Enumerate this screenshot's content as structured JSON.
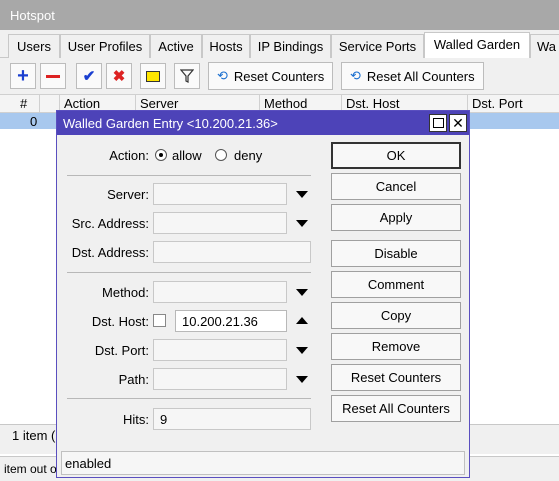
{
  "window": {
    "title": "Hotspot"
  },
  "tabs": [
    "Users",
    "User Profiles",
    "Active",
    "Hosts",
    "IP Bindings",
    "Service Ports",
    "Walled Garden",
    "Wa"
  ],
  "active_tab": "Walled Garden",
  "toolbar": {
    "reset_counters": "Reset Counters",
    "reset_all_counters": "Reset All Counters"
  },
  "grid": {
    "columns": [
      "#",
      "",
      "Action",
      "Server",
      "Method",
      "Dst. Host",
      "Dst. Port"
    ],
    "rows": [
      {
        "num": "0"
      }
    ]
  },
  "status": {
    "count": "1 item (",
    "bottom": "item out o"
  },
  "dialog": {
    "title": "Walled Garden Entry <10.200.21.36>",
    "labels": {
      "action": "Action:",
      "server": "Server:",
      "src_address": "Src. Address:",
      "dst_address": "Dst. Address:",
      "method": "Method:",
      "dst_host": "Dst. Host:",
      "dst_port": "Dst. Port:",
      "path": "Path:",
      "hits": "Hits:"
    },
    "action_options": {
      "allow": "allow",
      "deny": "deny",
      "selected": "allow"
    },
    "dst_host_value": "10.200.21.36",
    "hits_value": "9",
    "buttons": [
      "OK",
      "Cancel",
      "Apply",
      "Disable",
      "Comment",
      "Copy",
      "Remove",
      "Reset Counters",
      "Reset All Counters"
    ],
    "status": "enabled"
  },
  "colors": {
    "title_bar": "#4d43b8",
    "selected_row": "#a8c8ee",
    "window_title": "#a8a8a8"
  }
}
